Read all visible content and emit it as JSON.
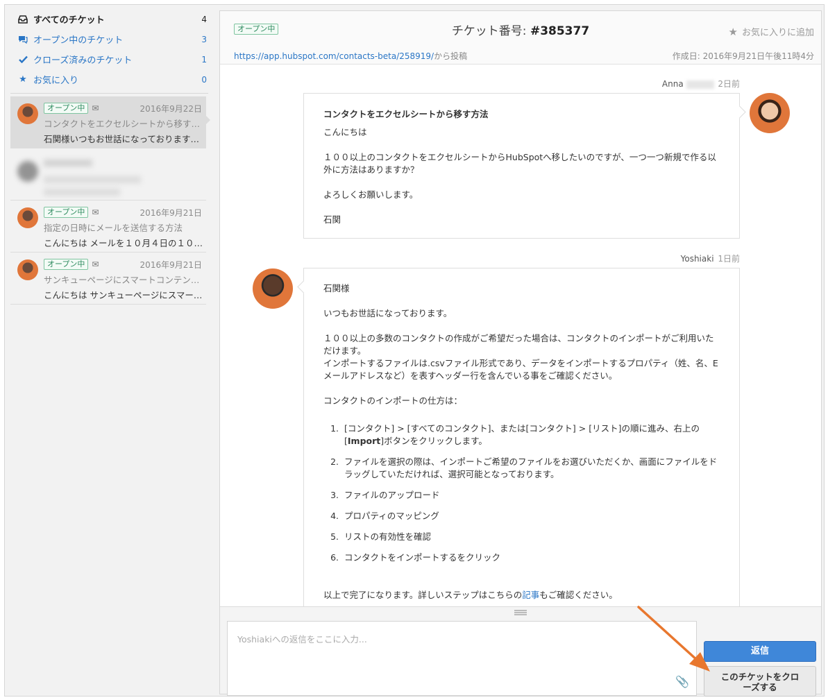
{
  "sidebar": {
    "folders": [
      {
        "icon": "inbox-icon",
        "label": "すべてのチケット",
        "count": "4"
      },
      {
        "icon": "chat-icon",
        "label": "オープン中のチケット",
        "count": "3"
      },
      {
        "icon": "check-icon",
        "label": "クローズ済みのチケット",
        "count": "1"
      },
      {
        "icon": "star-icon",
        "label": "お気に入り",
        "count": "0"
      }
    ],
    "tickets": [
      {
        "status": "オープン中",
        "date": "2016年9月22日",
        "subject": "コンタクトをエクセルシートから移す…",
        "preview": "石関様いつもお世話になっております…"
      },
      {
        "status": "",
        "date": "",
        "subject": "",
        "preview": ""
      },
      {
        "status": "オープン中",
        "date": "2016年9月21日",
        "subject": "指定の日時にメールを送信する方法",
        "preview": "こんにちは メールを１０月４日の１０…"
      },
      {
        "status": "オープン中",
        "date": "2016年9月21日",
        "subject": "サンキューページにスマートコンテン…",
        "preview": "こんにちは サンキューページにスマー…"
      }
    ]
  },
  "ticket": {
    "status": "オープン中",
    "title_prefix": "チケット番号: ",
    "number": "#385377",
    "favorite_label": "お気に入りに追加",
    "source_url": "https://app.hubspot.com/contacts-beta/258919/",
    "source_suffix": "から投稿",
    "created": "作成日: 2016年9月21日午後11時4分"
  },
  "messages": {
    "anna": {
      "name": "Anna",
      "ago": "2日前",
      "subject": "コンタクトをエクセルシートから移す方法",
      "p1": "こんにちは",
      "p2": "１００以上のコンタクトをエクセルシートからHubSpotへ移したいのですが、一つ一つ新規で作る以外に方法はありますか？",
      "p3": "よろしくお願いします。",
      "p4": "石関"
    },
    "yoshiaki": {
      "name": "Yoshiaki",
      "ago": "1日前",
      "p1": "石関様",
      "p2": "いつもお世話になっております。",
      "p3a": "１００以上の多数のコンタクトの作成がご希望だった場合は、コンタクトのインポートがご利用いただけます。",
      "p3b": "インポートするファイルは.csvファイル形式であり、データをインポートするプロパティ（姓、名、Eメールアドレスなど）を表すヘッダー行を含んでいる事をご確認ください。",
      "p4": "コンタクトのインポートの仕方は：",
      "step1a": "[コンタクト] > [すべてのコンタクト]、または[コンタクト] > [リスト]の順に進み、右上の[",
      "step1b": "Import",
      "step1c": "]ボタンをクリックします。",
      "step2": "ファイルを選択の際は、インポートご希望のファイルをお選びいただくか、画面にファイルをドラッグしていただければ、選択可能となっております。",
      "step3": "ファイルのアップロード",
      "step4": "プロパティのマッピング",
      "step5": "リストの有効性を確認",
      "step6": "コンタクトをインポートするをクリック",
      "closing_a": "以上で完了になります。詳しいステップはこちらの",
      "closing_link": "記事",
      "closing_b": "もご確認ください。"
    }
  },
  "reply": {
    "placeholder": "Yoshiakiへの返信をここに入力...",
    "send_label": "返信",
    "close_label": "このチケットをクローズする"
  },
  "colors": {
    "accent": "#3f87d9",
    "status_green": "#2d8a5e",
    "arrow": "#e8772e"
  }
}
